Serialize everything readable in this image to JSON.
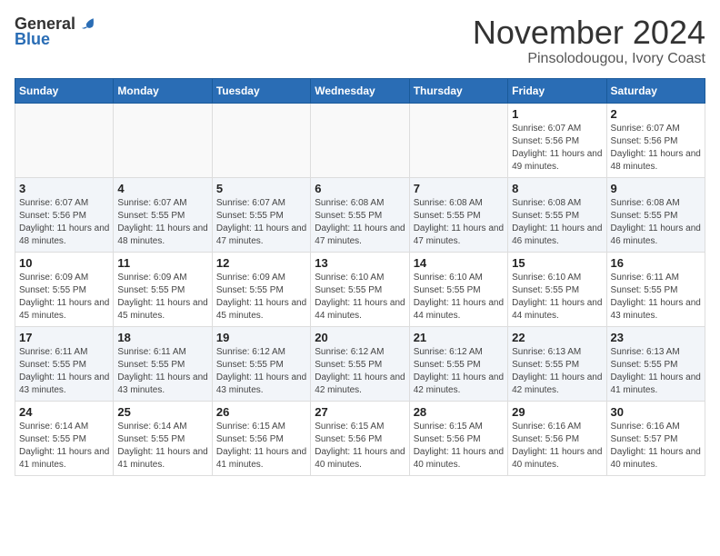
{
  "logo": {
    "general": "General",
    "blue": "Blue"
  },
  "header": {
    "month": "November 2024",
    "location": "Pinsolodougou, Ivory Coast"
  },
  "weekdays": [
    "Sunday",
    "Monday",
    "Tuesday",
    "Wednesday",
    "Thursday",
    "Friday",
    "Saturday"
  ],
  "weeks": [
    [
      {
        "day": "",
        "info": ""
      },
      {
        "day": "",
        "info": ""
      },
      {
        "day": "",
        "info": ""
      },
      {
        "day": "",
        "info": ""
      },
      {
        "day": "",
        "info": ""
      },
      {
        "day": "1",
        "info": "Sunrise: 6:07 AM\nSunset: 5:56 PM\nDaylight: 11 hours and 49 minutes."
      },
      {
        "day": "2",
        "info": "Sunrise: 6:07 AM\nSunset: 5:56 PM\nDaylight: 11 hours and 48 minutes."
      }
    ],
    [
      {
        "day": "3",
        "info": "Sunrise: 6:07 AM\nSunset: 5:56 PM\nDaylight: 11 hours and 48 minutes."
      },
      {
        "day": "4",
        "info": "Sunrise: 6:07 AM\nSunset: 5:55 PM\nDaylight: 11 hours and 48 minutes."
      },
      {
        "day": "5",
        "info": "Sunrise: 6:07 AM\nSunset: 5:55 PM\nDaylight: 11 hours and 47 minutes."
      },
      {
        "day": "6",
        "info": "Sunrise: 6:08 AM\nSunset: 5:55 PM\nDaylight: 11 hours and 47 minutes."
      },
      {
        "day": "7",
        "info": "Sunrise: 6:08 AM\nSunset: 5:55 PM\nDaylight: 11 hours and 47 minutes."
      },
      {
        "day": "8",
        "info": "Sunrise: 6:08 AM\nSunset: 5:55 PM\nDaylight: 11 hours and 46 minutes."
      },
      {
        "day": "9",
        "info": "Sunrise: 6:08 AM\nSunset: 5:55 PM\nDaylight: 11 hours and 46 minutes."
      }
    ],
    [
      {
        "day": "10",
        "info": "Sunrise: 6:09 AM\nSunset: 5:55 PM\nDaylight: 11 hours and 45 minutes."
      },
      {
        "day": "11",
        "info": "Sunrise: 6:09 AM\nSunset: 5:55 PM\nDaylight: 11 hours and 45 minutes."
      },
      {
        "day": "12",
        "info": "Sunrise: 6:09 AM\nSunset: 5:55 PM\nDaylight: 11 hours and 45 minutes."
      },
      {
        "day": "13",
        "info": "Sunrise: 6:10 AM\nSunset: 5:55 PM\nDaylight: 11 hours and 44 minutes."
      },
      {
        "day": "14",
        "info": "Sunrise: 6:10 AM\nSunset: 5:55 PM\nDaylight: 11 hours and 44 minutes."
      },
      {
        "day": "15",
        "info": "Sunrise: 6:10 AM\nSunset: 5:55 PM\nDaylight: 11 hours and 44 minutes."
      },
      {
        "day": "16",
        "info": "Sunrise: 6:11 AM\nSunset: 5:55 PM\nDaylight: 11 hours and 43 minutes."
      }
    ],
    [
      {
        "day": "17",
        "info": "Sunrise: 6:11 AM\nSunset: 5:55 PM\nDaylight: 11 hours and 43 minutes."
      },
      {
        "day": "18",
        "info": "Sunrise: 6:11 AM\nSunset: 5:55 PM\nDaylight: 11 hours and 43 minutes."
      },
      {
        "day": "19",
        "info": "Sunrise: 6:12 AM\nSunset: 5:55 PM\nDaylight: 11 hours and 43 minutes."
      },
      {
        "day": "20",
        "info": "Sunrise: 6:12 AM\nSunset: 5:55 PM\nDaylight: 11 hours and 42 minutes."
      },
      {
        "day": "21",
        "info": "Sunrise: 6:12 AM\nSunset: 5:55 PM\nDaylight: 11 hours and 42 minutes."
      },
      {
        "day": "22",
        "info": "Sunrise: 6:13 AM\nSunset: 5:55 PM\nDaylight: 11 hours and 42 minutes."
      },
      {
        "day": "23",
        "info": "Sunrise: 6:13 AM\nSunset: 5:55 PM\nDaylight: 11 hours and 41 minutes."
      }
    ],
    [
      {
        "day": "24",
        "info": "Sunrise: 6:14 AM\nSunset: 5:55 PM\nDaylight: 11 hours and 41 minutes."
      },
      {
        "day": "25",
        "info": "Sunrise: 6:14 AM\nSunset: 5:55 PM\nDaylight: 11 hours and 41 minutes."
      },
      {
        "day": "26",
        "info": "Sunrise: 6:15 AM\nSunset: 5:56 PM\nDaylight: 11 hours and 41 minutes."
      },
      {
        "day": "27",
        "info": "Sunrise: 6:15 AM\nSunset: 5:56 PM\nDaylight: 11 hours and 40 minutes."
      },
      {
        "day": "28",
        "info": "Sunrise: 6:15 AM\nSunset: 5:56 PM\nDaylight: 11 hours and 40 minutes."
      },
      {
        "day": "29",
        "info": "Sunrise: 6:16 AM\nSunset: 5:56 PM\nDaylight: 11 hours and 40 minutes."
      },
      {
        "day": "30",
        "info": "Sunrise: 6:16 AM\nSunset: 5:57 PM\nDaylight: 11 hours and 40 minutes."
      }
    ]
  ]
}
